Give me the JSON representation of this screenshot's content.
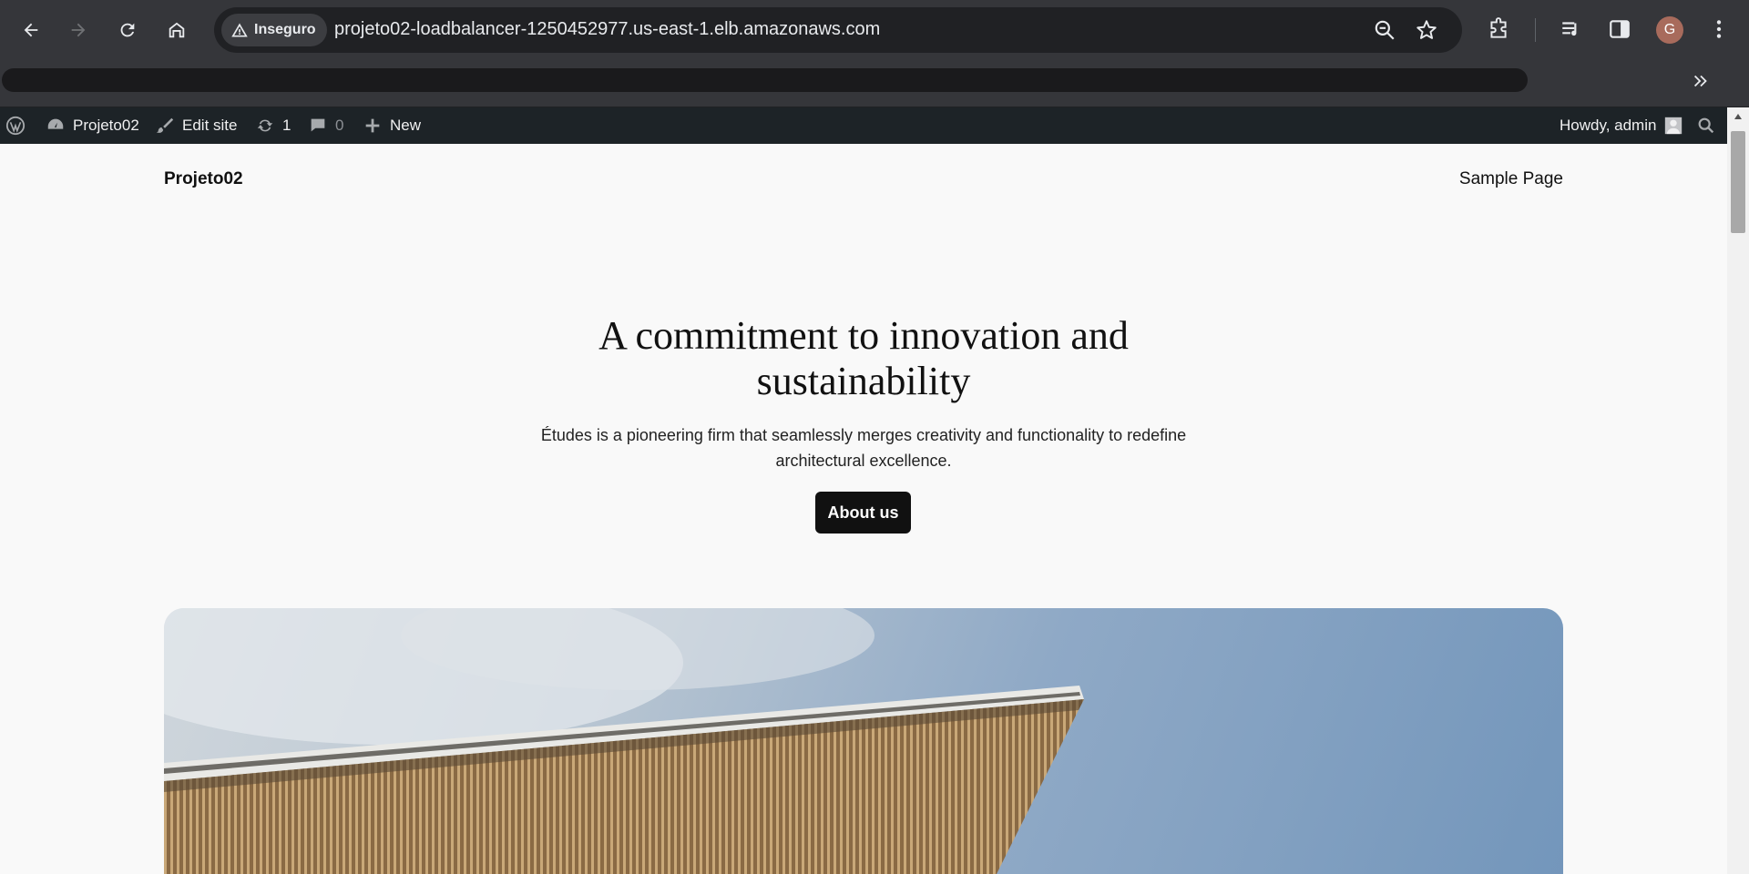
{
  "browser": {
    "security_label": "Inseguro",
    "url": "projeto02-loadbalancer-1250452977.us-east-1.elb.amazonaws.com",
    "profile_initial": "G"
  },
  "adminbar": {
    "site_name": "Projeto02",
    "edit_site": "Edit site",
    "updates_count": "1",
    "comments_count": "0",
    "new_label": "New",
    "howdy": "Howdy, admin"
  },
  "page": {
    "site_title": "Projeto02",
    "nav_item": "Sample Page",
    "hero_heading": "A commitment to innovation and sustainability",
    "hero_text": "Études is a pioneering firm that seamlessly merges creativity and functionality to redefine architectural excellence.",
    "cta_label": "About us"
  },
  "colors": {
    "chrome_bg": "#35363a",
    "omnibox_bg": "#202124",
    "adminbar_bg": "#1d2327",
    "page_bg": "#f9f9f9",
    "button_bg": "#111111"
  }
}
